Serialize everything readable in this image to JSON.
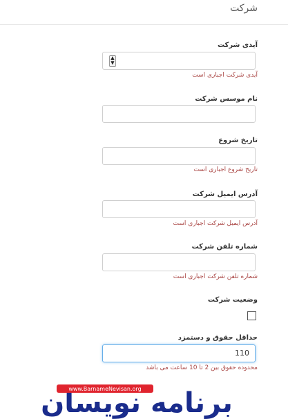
{
  "header": {
    "title": "شرکت"
  },
  "fields": {
    "company_id": {
      "label": "آیدی شرکت",
      "value": "",
      "error": "آیدی شرکت اجباری است"
    },
    "founder_name": {
      "label": "نام موسس شرکت",
      "value": ""
    },
    "start_date": {
      "label": "تاریخ شروع",
      "value": "",
      "error": "تاریخ شروع اجباری است"
    },
    "email": {
      "label": "آدرس ایمیل شرکت",
      "value": "",
      "error": "آدرس ایمیل شرکت اجباری است"
    },
    "phone": {
      "label": "شماره تلفن شرکت",
      "value": "",
      "error": "شماره تلفن شرکت اجباری است"
    },
    "status": {
      "label": "وضعیت شرکت",
      "checked": false
    },
    "min_wage": {
      "label": "حداقل حقوق و دستمزد",
      "value": "110",
      "error": "محدوده حقوق بین 2 تا 10 ساعت می باشد"
    }
  },
  "logo": {
    "text": "برنامه نویسان",
    "url_text": "www.BarnameNevisan.org"
  },
  "colors": {
    "error": "#a94442",
    "focus": "#66afe9",
    "logo_blue": "#1a2c8c",
    "logo_red": "#e0242e"
  }
}
